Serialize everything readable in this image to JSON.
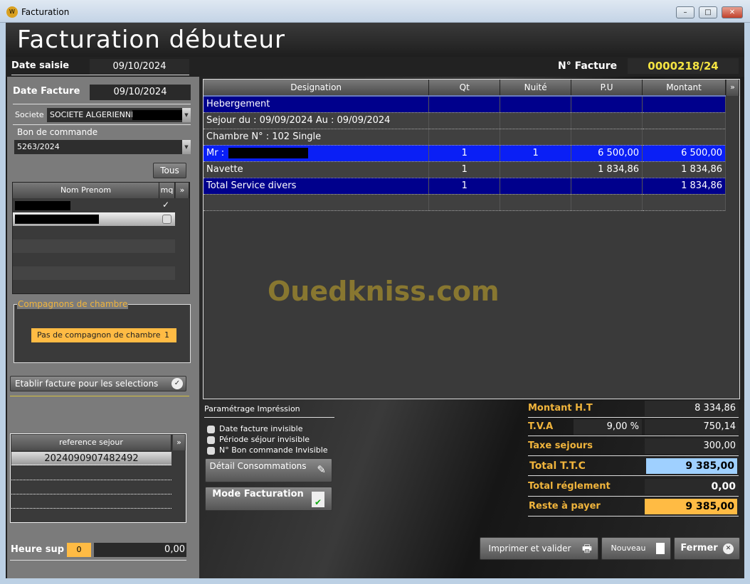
{
  "window": {
    "title": "Facturation",
    "controls": [
      "minimize",
      "maximize",
      "close"
    ]
  },
  "header": {
    "title": "Facturation débuteur"
  },
  "date_saisie": {
    "label": "Date saisie",
    "value": "09/10/2024"
  },
  "facture": {
    "label": "N° Facture",
    "value": "0000218/24"
  },
  "left": {
    "date_facture": {
      "label": "Date Facture",
      "value": "09/10/2024"
    },
    "societe": {
      "label": "Societe",
      "value": "SOCIETE ALGERIENNE I"
    },
    "bon_commande": {
      "label": "Bon de commande",
      "value": "5263/2024"
    },
    "tous_button": "Tous",
    "guests": {
      "columns": [
        "Nom Prenom",
        "mq"
      ],
      "rows": [
        {
          "checked": true
        },
        {
          "checked": false
        }
      ]
    },
    "compagnons": {
      "legend": "Compagnons de chambre",
      "item": "Pas de compagnon de chambre",
      "count": "1"
    },
    "etablir_button": "Etablir facture pour les selections",
    "sejour": {
      "column": "reference sejour",
      "rows": [
        "2024090907482492"
      ]
    },
    "heure_sup": {
      "label": "Heure sup",
      "count": "0",
      "value": "0,00"
    }
  },
  "table": {
    "columns": [
      "Designation",
      "Qt",
      "Nuité",
      "P.U",
      "Montant"
    ],
    "rows": [
      {
        "style": "dark",
        "designation": "Hebergement",
        "qt": "",
        "nuite": "",
        "pu": "",
        "montant": ""
      },
      {
        "style": "norm",
        "designation": "Sejour du :  09/09/2024   Au :  09/09/2024",
        "qt": "",
        "nuite": "",
        "pu": "",
        "montant": ""
      },
      {
        "style": "norm",
        "designation": "Chambre N°  :  102     Single",
        "qt": "",
        "nuite": "",
        "pu": "",
        "montant": ""
      },
      {
        "style": "blue",
        "designation": "Mr :",
        "qt": "1",
        "nuite": "1",
        "pu": "6  500,00",
        "montant": "6  500,00"
      },
      {
        "style": "norm",
        "designation": "Navette",
        "qt": "1",
        "nuite": "",
        "pu": "1  834,86",
        "montant": "1  834,86"
      },
      {
        "style": "dark",
        "designation": "Total Service divers",
        "qt": "1",
        "nuite": "",
        "pu": "",
        "montant": "1  834,86"
      },
      {
        "style": "norm",
        "designation": "",
        "qt": "",
        "nuite": "",
        "pu": "",
        "montant": ""
      }
    ]
  },
  "watermark": "Ouedkniss.com",
  "print": {
    "title": "Paramétrage Impréssion",
    "options": [
      "Date facture invisible",
      "Période séjour invisible",
      "N° Bon commande Invisible"
    ],
    "detail_button": "Détail Consommations",
    "mode_button": "Mode Facturation"
  },
  "totals": {
    "ht": {
      "label": "Montant H.T",
      "value": "8  334,86"
    },
    "tva": {
      "label": "T.V.A",
      "rate": "9,00 %",
      "value": "750,14"
    },
    "taxe": {
      "label": "Taxe sejours",
      "value": "300,00"
    },
    "ttc": {
      "label": "Total T.T.C",
      "value": "9  385,00"
    },
    "reglement": {
      "label": "Total réglement",
      "value": "0,00"
    },
    "reste": {
      "label": "Reste à payer",
      "value": "9  385,00"
    }
  },
  "actions": {
    "imprimer": "Imprimer et valider",
    "nouveau": "Nouveau",
    "fermer": "Fermer"
  },
  "colors": {
    "accent": "#f0b43c",
    "highlight_blue": "#0a1ff5",
    "dark_blue": "#00008c",
    "ttc_bg": "#9fd0ff",
    "reste_bg": "#ffbb44"
  }
}
